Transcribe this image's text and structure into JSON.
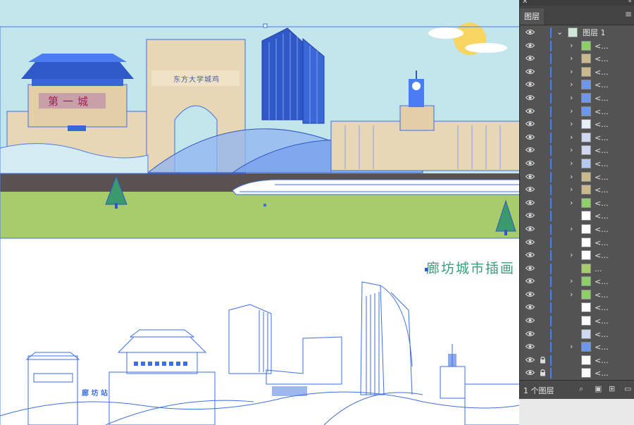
{
  "canvas": {
    "caption": "廊坊城市插画",
    "gate_sign": "第一城",
    "arch_sign": "东方大学城鸡",
    "station_sign": "廊 坊 站"
  },
  "panel": {
    "title": "图层",
    "top_layer": "图层 1",
    "footer": "1 个图层",
    "sublayer_label": "<...",
    "group_label": "...",
    "accent": "#4a7cf2"
  },
  "layers": [
    {
      "thumb": "tree",
      "chevron": true,
      "lock": false,
      "name": "<..."
    },
    {
      "thumb": "gate",
      "chevron": true,
      "lock": false,
      "name": "<..."
    },
    {
      "thumb": "gate",
      "chevron": true,
      "lock": false,
      "name": "<..."
    },
    {
      "thumb": "tower",
      "chevron": true,
      "lock": false,
      "name": "<..."
    },
    {
      "thumb": "tower",
      "chevron": true,
      "lock": false,
      "name": "<..."
    },
    {
      "thumb": "tower",
      "chevron": true,
      "lock": false,
      "name": "<..."
    },
    {
      "thumb": "train",
      "chevron": true,
      "lock": false,
      "name": "<..."
    },
    {
      "thumb": "line",
      "chevron": true,
      "lock": false,
      "name": "<..."
    },
    {
      "thumb": "line",
      "chevron": true,
      "lock": false,
      "name": "<..."
    },
    {
      "thumb": "bridge",
      "chevron": true,
      "lock": false,
      "name": "<..."
    },
    {
      "thumb": "gate",
      "chevron": true,
      "lock": false,
      "name": "<..."
    },
    {
      "thumb": "gate",
      "chevron": true,
      "lock": false,
      "name": "<..."
    },
    {
      "thumb": "tree",
      "chevron": true,
      "lock": false,
      "name": "<..."
    },
    {
      "thumb": "blank",
      "chevron": false,
      "lock": false,
      "name": "<..."
    },
    {
      "thumb": "blank",
      "chevron": true,
      "lock": false,
      "name": "<..."
    },
    {
      "thumb": "blank",
      "chevron": false,
      "lock": false,
      "name": "<..."
    },
    {
      "thumb": "blank",
      "chevron": true,
      "lock": false,
      "name": "<..."
    },
    {
      "thumb": "grass",
      "chevron": false,
      "lock": false,
      "name": "..."
    },
    {
      "thumb": "tree",
      "chevron": true,
      "lock": false,
      "name": "<..."
    },
    {
      "thumb": "tree",
      "chevron": true,
      "lock": false,
      "name": "<..."
    },
    {
      "thumb": "blank",
      "chevron": false,
      "lock": false,
      "name": "<..."
    },
    {
      "thumb": "blank",
      "chevron": false,
      "lock": false,
      "name": "<..."
    },
    {
      "thumb": "line",
      "chevron": false,
      "lock": false,
      "name": "<..."
    },
    {
      "thumb": "tower",
      "chevron": true,
      "lock": false,
      "name": "<..."
    },
    {
      "thumb": "blank",
      "chevron": false,
      "lock": true,
      "name": "<..."
    },
    {
      "thumb": "blank",
      "chevron": false,
      "lock": true,
      "name": "<..."
    }
  ]
}
